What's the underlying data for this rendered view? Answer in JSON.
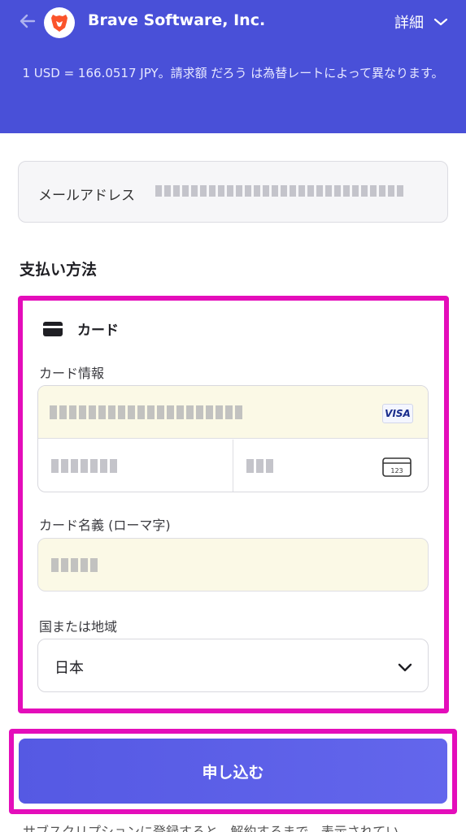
{
  "header": {
    "merchant_name": "Brave Software, Inc.",
    "details_label": "詳細",
    "exchange_note": "1 USD = 166.0517 JPY。請求額 だろう は為替レートによって異なります。",
    "background_color": "#4950d8",
    "back_icon": "arrow-left-icon",
    "logo_icon": "brave-lion-logo"
  },
  "email": {
    "label": "メールアドレス"
  },
  "payment": {
    "title": "支払い方法",
    "tab_label": "カード",
    "tab_icon": "credit-card-icon",
    "card_info_label": "カード情報",
    "card_brand": "VISA",
    "cvc_icon_text": "123",
    "cardholder_label": "カード名義 (ローマ字)",
    "country_label": "国または地域",
    "country_value": "日本"
  },
  "submit": {
    "label": "申し込む",
    "color": "#5559e3"
  },
  "footer": {
    "note": "サブスクリプションに登録すると、解約するまで、表示されてい"
  },
  "highlight_color": "#e40dba"
}
